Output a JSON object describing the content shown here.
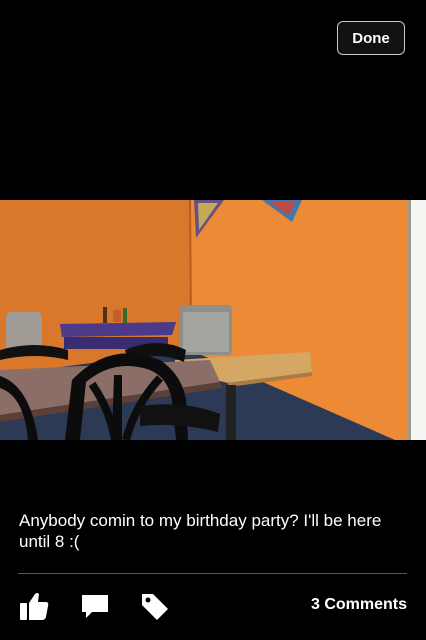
{
  "header": {
    "done_label": "Done"
  },
  "photo": {
    "description_icon": "photo"
  },
  "post": {
    "caption": "Anybody comin to my birthday party? I'll be here until 8 :("
  },
  "actions": {
    "like_icon": "thumbs-up-icon",
    "comment_icon": "speech-bubble-icon",
    "tag_icon": "tag-icon",
    "comments_label": "3 Comments"
  }
}
